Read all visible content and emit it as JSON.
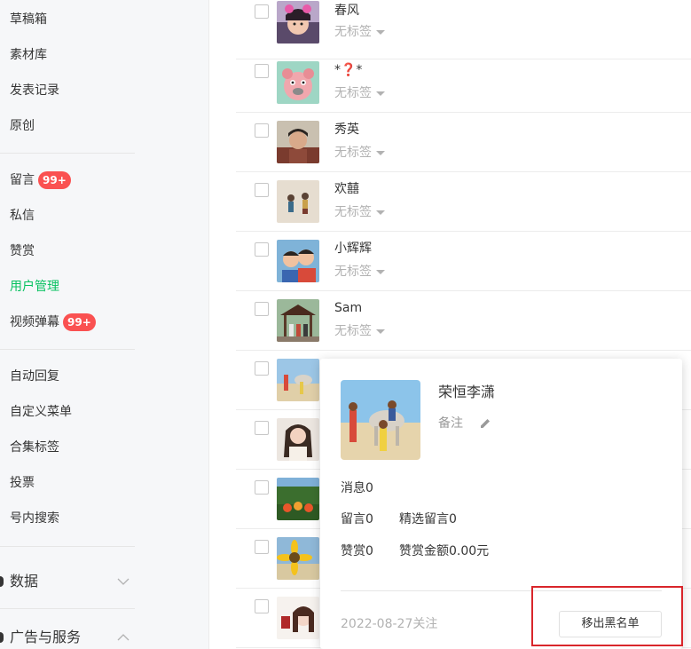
{
  "sidebar": {
    "items": [
      {
        "label": "草稿箱"
      },
      {
        "label": "素材库"
      },
      {
        "label": "发表记录"
      },
      {
        "label": "原创"
      },
      {
        "label": "留言",
        "badge": "99+"
      },
      {
        "label": "私信"
      },
      {
        "label": "赞赏"
      },
      {
        "label": "用户管理",
        "active": true
      },
      {
        "label": "视频弹幕",
        "badge": "99+"
      },
      {
        "label": "自动回复"
      },
      {
        "label": "自定义菜单"
      },
      {
        "label": "合集标签"
      },
      {
        "label": "投票"
      },
      {
        "label": "号内搜索"
      }
    ],
    "sections": [
      {
        "label": "数据",
        "state": "collapsed",
        "icon": "chevron-down-icon"
      },
      {
        "label": "广告与服务",
        "state": "expanded",
        "icon": "chevron-up-icon"
      }
    ]
  },
  "users": [
    {
      "name": "春风",
      "tag": "无标签"
    },
    {
      "name": "*❓*",
      "tag": "无标签"
    },
    {
      "name": "秀英",
      "tag": "无标签"
    },
    {
      "name": "欢囍",
      "tag": "无标签"
    },
    {
      "name": "小辉辉",
      "tag": "无标签"
    },
    {
      "name": "Sam",
      "tag": "无标签"
    },
    {
      "name": "",
      "tag": ""
    },
    {
      "name": "",
      "tag": ""
    },
    {
      "name": "",
      "tag": ""
    },
    {
      "name": "",
      "tag": ""
    },
    {
      "name": "",
      "tag": ""
    }
  ],
  "profile_card": {
    "name": "荣恒李潇",
    "remark_label": "备注",
    "messages": "消息0",
    "comments": "留言0",
    "featured_comments": "精选留言0",
    "likes": "赞赏0",
    "like_amount": "赞赏金额0.00元",
    "follow_date": "2022-08-27关注",
    "remove_blacklist_button": "移出黑名单"
  },
  "colors": {
    "accent": "#07c160",
    "badge": "#fa5151",
    "highlight": "#d9262b"
  }
}
